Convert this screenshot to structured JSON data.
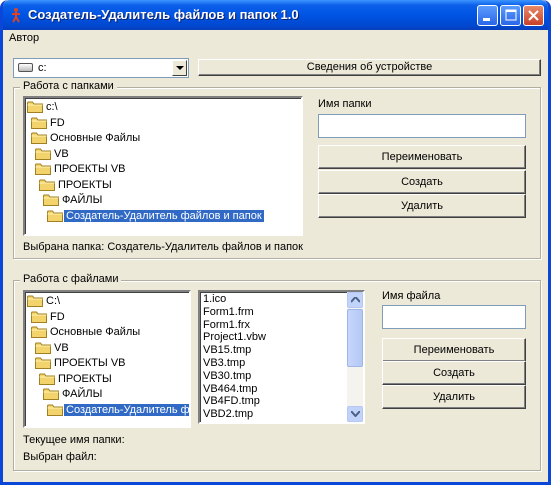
{
  "window": {
    "title": "Создатель-Удалитель файлов и папок 1.0"
  },
  "menu": {
    "items": [
      "Автор"
    ]
  },
  "drive": {
    "selected": "c:",
    "info_button": "Сведения об устройстве"
  },
  "folders_group": {
    "legend": "Работа с папками",
    "tree": [
      {
        "label": "c:\\",
        "level": 0,
        "selected": false
      },
      {
        "label": "FD",
        "level": 1,
        "selected": false
      },
      {
        "label": "Основные Файлы",
        "level": 1,
        "selected": false
      },
      {
        "label": "VB",
        "level": 2,
        "selected": false
      },
      {
        "label": "ПРОЕКТЫ VB",
        "level": 2,
        "selected": false
      },
      {
        "label": "ПРОЕКТЫ",
        "level": 3,
        "selected": false
      },
      {
        "label": "ФАЙЛЫ",
        "level": 4,
        "selected": false
      },
      {
        "label": "Создатель-Удалитель файлов и папок",
        "level": 5,
        "selected": true
      }
    ],
    "name_label": "Имя папки",
    "name_value": "",
    "rename_button": "Переименовать",
    "create_button": "Создать",
    "delete_button": "Удалить",
    "selected_text": "Выбрана папка: Создатель-Удалитель файлов и папок"
  },
  "files_group": {
    "legend": "Работа с файлами",
    "tree": [
      {
        "label": "C:\\",
        "level": 0,
        "selected": false
      },
      {
        "label": "FD",
        "level": 1,
        "selected": false
      },
      {
        "label": "Основные Файлы",
        "level": 1,
        "selected": false
      },
      {
        "label": "VB",
        "level": 2,
        "selected": false
      },
      {
        "label": "ПРОЕКТЫ VB",
        "level": 2,
        "selected": false
      },
      {
        "label": "ПРОЕКТЫ",
        "level": 3,
        "selected": false
      },
      {
        "label": "ФАЙЛЫ",
        "level": 4,
        "selected": false
      },
      {
        "label": "Создатель-Удалитель файлов и папок",
        "level": 5,
        "selected": true
      }
    ],
    "files": [
      "1.ico",
      "Form1.frm",
      "Form1.frx",
      "Project1.vbw",
      "VB15.tmp",
      "VB3.tmp",
      "VB30.tmp",
      "VB464.tmp",
      "VB4FD.tmp",
      "VBD2.tmp"
    ],
    "name_label": "Имя файла",
    "name_value": "",
    "rename_button": "Переименовать",
    "create_button": "Создать",
    "delete_button": "Удалить",
    "current_folder_text": "Текущее имя папки:",
    "selected_file_text": "Выбран файл:"
  },
  "icons": {
    "app": "red-figure-icon",
    "folder": "folder-icon",
    "drive": "drive-icon"
  },
  "colors": {
    "titlebar": "#0054e3",
    "selection": "#316ac5",
    "face": "#ece9d8"
  }
}
